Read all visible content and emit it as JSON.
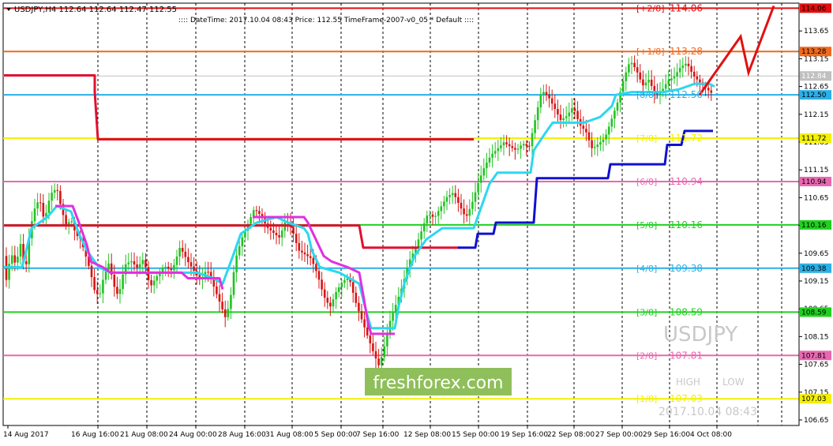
{
  "header": {
    "symbol_line": "USDJPY,H4  112.64 112.64 112.47 112.55",
    "info_line": ":::: DateTime: 2017.10.04 08:43   Price: 112.55   TimeFrame-2007-v0_05     *    Default   ::::"
  },
  "watermark": {
    "symbol": "USDJPY",
    "brand": "freshforex.com",
    "high_label": "HIGH",
    "low_label": "LOW",
    "datetime": "2017.10.04 08:43"
  },
  "chart_data": {
    "type": "candlestick",
    "ylim": [
      106.55,
      114.15
    ],
    "y_ticks": [
      "113.65",
      "113.15",
      "112.65",
      "112.15",
      "111.65",
      "111.15",
      "110.65",
      "110.15",
      "109.65",
      "109.15",
      "108.65",
      "108.15",
      "107.65",
      "107.15",
      "106.65"
    ],
    "x_ticks": [
      "14 Aug 2017",
      "16 Aug 16:00",
      "21 Aug 08:00",
      "24 Aug 00:00",
      "28 Aug 16:00",
      "31 Aug 08:00",
      "5 Sep 00:00",
      "7 Sep 16:00",
      "12 Sep 08:00",
      "15 Sep 00:00",
      "19 Sep 16:00",
      "22 Sep 08:00",
      "27 Sep 00:00",
      "29 Sep 16:00",
      "4 Oct 08:00"
    ],
    "levels": [
      {
        "label": "[+2/8]",
        "value": "114.06",
        "color": "#e01010",
        "price_tag": "114.06"
      },
      {
        "label": "[+1/8]",
        "value": "113.28",
        "color": "#ee6a1e",
        "price_tag": "113.28"
      },
      {
        "label": "[8/8]",
        "value": "112.50",
        "color": "#2ab0e8",
        "price_tag": "112.50"
      },
      {
        "label": "[7/8]",
        "value": "111.72",
        "color": "#f4f000",
        "price_tag": "111.72"
      },
      {
        "label": "[6/8]",
        "value": "110.94",
        "color": "#e868b0",
        "price_tag": "110.94"
      },
      {
        "label": "[5/8]",
        "value": "110.16",
        "color": "#20d020",
        "price_tag": "110.16"
      },
      {
        "label": "[4/8]",
        "value": "109.38",
        "color": "#2ab0e8",
        "price_tag": "109.38"
      },
      {
        "label": "[3/8]",
        "value": "108.59",
        "color": "#20d020",
        "price_tag": "108.59"
      },
      {
        "label": "[2/8]",
        "value": "107.81",
        "color": "#e868b0",
        "price_tag": "107.81"
      },
      {
        "label": "[1/8]",
        "value": "107.03",
        "color": "#f4f000",
        "price_tag": "107.03"
      }
    ],
    "current_price_tag": "112.84",
    "close_path": [
      [
        0,
        109.1
      ],
      [
        6,
        109.6
      ],
      [
        12,
        109.4
      ],
      [
        18,
        109.8
      ],
      [
        24,
        109.3
      ],
      [
        30,
        110.1
      ],
      [
        36,
        110.5
      ],
      [
        42,
        110.7
      ],
      [
        48,
        110.3
      ],
      [
        56,
        110.8
      ],
      [
        64,
        110.9
      ],
      [
        70,
        110.5
      ],
      [
        76,
        110.2
      ],
      [
        82,
        110.3
      ],
      [
        88,
        110.0
      ],
      [
        94,
        109.9
      ],
      [
        100,
        109.6
      ],
      [
        106,
        109.3
      ],
      [
        112,
        108.9
      ],
      [
        118,
        108.8
      ],
      [
        124,
        109.2
      ],
      [
        130,
        109.4
      ],
      [
        136,
        109.0
      ],
      [
        142,
        108.8
      ],
      [
        150,
        109.4
      ],
      [
        158,
        109.5
      ],
      [
        166,
        109.4
      ],
      [
        174,
        109.6
      ],
      [
        182,
        109.1
      ],
      [
        190,
        109.3
      ],
      [
        200,
        109.5
      ],
      [
        210,
        109.4
      ],
      [
        220,
        109.8
      ],
      [
        230,
        109.5
      ],
      [
        238,
        109.3
      ],
      [
        246,
        109.1
      ],
      [
        254,
        109.3
      ],
      [
        262,
        109.0
      ],
      [
        270,
        108.7
      ],
      [
        278,
        108.4
      ],
      [
        284,
        108.8
      ],
      [
        290,
        109.5
      ],
      [
        298,
        109.9
      ],
      [
        306,
        110.2
      ],
      [
        314,
        110.5
      ],
      [
        322,
        110.4
      ],
      [
        330,
        110.2
      ],
      [
        338,
        110.1
      ],
      [
        346,
        110.0
      ],
      [
        354,
        110.3
      ],
      [
        362,
        110.1
      ],
      [
        370,
        109.7
      ],
      [
        378,
        109.6
      ],
      [
        386,
        109.5
      ],
      [
        394,
        109.2
      ],
      [
        402,
        108.8
      ],
      [
        410,
        108.6
      ],
      [
        418,
        108.9
      ],
      [
        426,
        109.1
      ],
      [
        434,
        109.2
      ],
      [
        442,
        108.8
      ],
      [
        450,
        108.5
      ],
      [
        458,
        108.2
      ],
      [
        466,
        107.9
      ],
      [
        472,
        107.7
      ],
      [
        478,
        108.0
      ],
      [
        486,
        108.5
      ],
      [
        494,
        108.8
      ],
      [
        502,
        109.1
      ],
      [
        510,
        109.5
      ],
      [
        518,
        109.7
      ],
      [
        526,
        110.0
      ],
      [
        534,
        110.3
      ],
      [
        542,
        110.2
      ],
      [
        550,
        110.4
      ],
      [
        558,
        110.6
      ],
      [
        566,
        110.7
      ],
      [
        574,
        110.5
      ],
      [
        582,
        110.3
      ],
      [
        590,
        110.6
      ],
      [
        598,
        111.0
      ],
      [
        606,
        111.3
      ],
      [
        614,
        111.5
      ],
      [
        622,
        111.6
      ],
      [
        630,
        111.7
      ],
      [
        638,
        111.6
      ],
      [
        646,
        111.5
      ],
      [
        654,
        111.6
      ],
      [
        662,
        111.5
      ],
      [
        670,
        112.0
      ],
      [
        678,
        112.5
      ],
      [
        686,
        112.4
      ],
      [
        694,
        112.2
      ],
      [
        702,
        112.0
      ],
      [
        710,
        112.1
      ],
      [
        718,
        112.3
      ],
      [
        726,
        112.0
      ],
      [
        734,
        111.9
      ],
      [
        742,
        111.6
      ],
      [
        750,
        111.7
      ],
      [
        758,
        111.8
      ],
      [
        766,
        112.1
      ],
      [
        774,
        112.4
      ],
      [
        782,
        112.8
      ],
      [
        790,
        113.1
      ],
      [
        798,
        112.9
      ],
      [
        806,
        112.6
      ],
      [
        814,
        112.7
      ],
      [
        822,
        112.4
      ],
      [
        830,
        112.5
      ],
      [
        838,
        112.7
      ],
      [
        846,
        112.8
      ],
      [
        854,
        113.0
      ],
      [
        862,
        113.1
      ],
      [
        870,
        112.9
      ],
      [
        878,
        112.8
      ],
      [
        886,
        112.7
      ],
      [
        894,
        112.6
      ],
      [
        900,
        112.55
      ]
    ],
    "indicator_lines": [
      {
        "color": "#e01030",
        "points": [
          [
            5,
            112.85
          ],
          [
            120,
            112.85
          ],
          [
            120,
            112.55
          ],
          [
            124,
            111.7
          ],
          [
            600,
            111.7
          ]
        ]
      },
      {
        "color": "#e01030",
        "points": [
          [
            5,
            110.15
          ],
          [
            455,
            110.15
          ],
          [
            460,
            109.75
          ],
          [
            582,
            109.75
          ]
        ]
      },
      {
        "color": "#1010d0",
        "points": [
          [
            580,
            109.75
          ],
          [
            602,
            109.75
          ],
          [
            605,
            110.0
          ],
          [
            625,
            110.0
          ],
          [
            628,
            110.2
          ],
          [
            676,
            110.2
          ],
          [
            680,
            111.0
          ],
          [
            770,
            111.0
          ],
          [
            773,
            111.25
          ],
          [
            842,
            111.25
          ],
          [
            845,
            111.6
          ],
          [
            863,
            111.6
          ],
          [
            867,
            111.85
          ],
          [
            903,
            111.85
          ]
        ]
      },
      {
        "color": "#2ad8f0",
        "points": [
          [
            5,
            109.4
          ],
          [
            28,
            109.4
          ],
          [
            40,
            110.1
          ],
          [
            60,
            110.3
          ],
          [
            72,
            110.5
          ],
          [
            90,
            110.4
          ],
          [
            100,
            110.0
          ],
          [
            110,
            109.7
          ],
          [
            125,
            109.4
          ],
          [
            140,
            109.3
          ],
          [
            220,
            109.3
          ],
          [
            250,
            109.3
          ],
          [
            270,
            109.2
          ],
          [
            282,
            109.1
          ],
          [
            295,
            109.6
          ],
          [
            305,
            110.0
          ],
          [
            325,
            110.2
          ],
          [
            350,
            110.3
          ],
          [
            365,
            110.2
          ],
          [
            385,
            110.1
          ],
          [
            390,
            110.0
          ],
          [
            395,
            109.7
          ],
          [
            405,
            109.4
          ],
          [
            430,
            109.3
          ],
          [
            455,
            109.1
          ],
          [
            462,
            108.7
          ],
          [
            470,
            108.3
          ],
          [
            500,
            108.3
          ],
          [
            505,
            108.7
          ],
          [
            512,
            109.1
          ],
          [
            525,
            109.6
          ],
          [
            540,
            109.9
          ],
          [
            560,
            110.1
          ],
          [
            600,
            110.1
          ],
          [
            610,
            110.5
          ],
          [
            620,
            110.9
          ],
          [
            630,
            111.1
          ],
          [
            672,
            111.1
          ],
          [
            676,
            111.5
          ],
          [
            690,
            111.8
          ],
          [
            700,
            112.0
          ],
          [
            740,
            112.0
          ],
          [
            760,
            112.1
          ],
          [
            775,
            112.3
          ],
          [
            780,
            112.5
          ],
          [
            800,
            112.55
          ],
          [
            840,
            112.55
          ],
          [
            860,
            112.6
          ],
          [
            880,
            112.7
          ],
          [
            898,
            112.7
          ],
          [
            905,
            112.65
          ]
        ]
      },
      {
        "color": "#e030e0",
        "points": [
          [
            70,
            110.5
          ],
          [
            92,
            110.5
          ],
          [
            100,
            110.2
          ],
          [
            110,
            109.8
          ],
          [
            115,
            109.5
          ],
          [
            130,
            109.4
          ],
          [
            140,
            109.3
          ],
          [
            230,
            109.3
          ],
          [
            238,
            109.2
          ],
          [
            278,
            109.2
          ],
          [
            282,
            109.0
          ]
        ]
      },
      {
        "color": "#e030e0",
        "points": [
          [
            320,
            110.3
          ],
          [
            385,
            110.3
          ],
          [
            390,
            110.2
          ],
          [
            400,
            109.9
          ],
          [
            410,
            109.6
          ],
          [
            420,
            109.5
          ],
          [
            440,
            109.4
          ],
          [
            455,
            109.3
          ],
          [
            460,
            108.9
          ],
          [
            466,
            108.4
          ],
          [
            470,
            108.2
          ],
          [
            500,
            108.2
          ]
        ]
      }
    ],
    "projection": {
      "color": "#e01010",
      "points": [
        [
          886,
          112.5
        ],
        [
          938,
          113.55
        ],
        [
          948,
          112.9
        ],
        [
          980,
          114.1
        ]
      ]
    }
  }
}
